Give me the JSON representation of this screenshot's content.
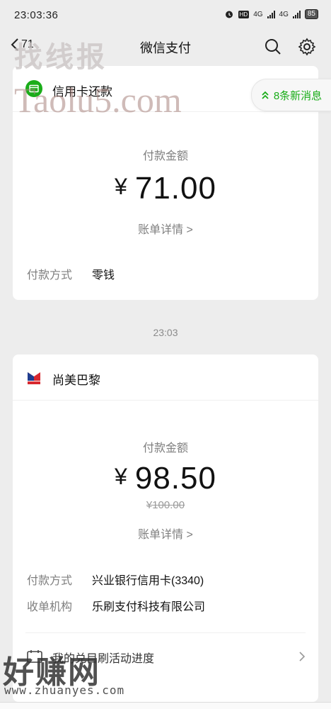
{
  "status_bar": {
    "time": "23:03:36",
    "net1": "4G",
    "net2": "4G",
    "battery": "85"
  },
  "nav": {
    "back_count": "71",
    "title": "微信支付",
    "search_icon": "search-icon",
    "settings_icon": "gear-icon"
  },
  "notification": {
    "label": "8条新消息"
  },
  "card1": {
    "merchant": "信用卡还款",
    "amount_label": "付款金额",
    "currency": "¥",
    "amount": "71.00",
    "detail_link": "账单详情 >",
    "pay_method_key": "付款方式",
    "pay_method_value": "零钱"
  },
  "time_separator": "23:03",
  "card2": {
    "merchant": "尚美巴黎",
    "amount_label": "付款金额",
    "currency": "¥",
    "amount": "98.50",
    "original_amount": "¥100.00",
    "detail_link": "账单详情 >",
    "pay_method_key": "付款方式",
    "pay_method_value": "兴业银行信用卡(3340)",
    "acquirer_key": "收单机构",
    "acquirer_value": "乐刷支付科技有限公司",
    "promo_label": "我的兑目刷活动进度"
  },
  "watermarks": {
    "top_cn": "找线报",
    "top_en": "Taolu5.com",
    "bottom_cn": "好赚网",
    "bottom_en": "www.zhuanyes.com"
  },
  "colors": {
    "brand_green": "#1aad19",
    "background": "#ededed"
  }
}
